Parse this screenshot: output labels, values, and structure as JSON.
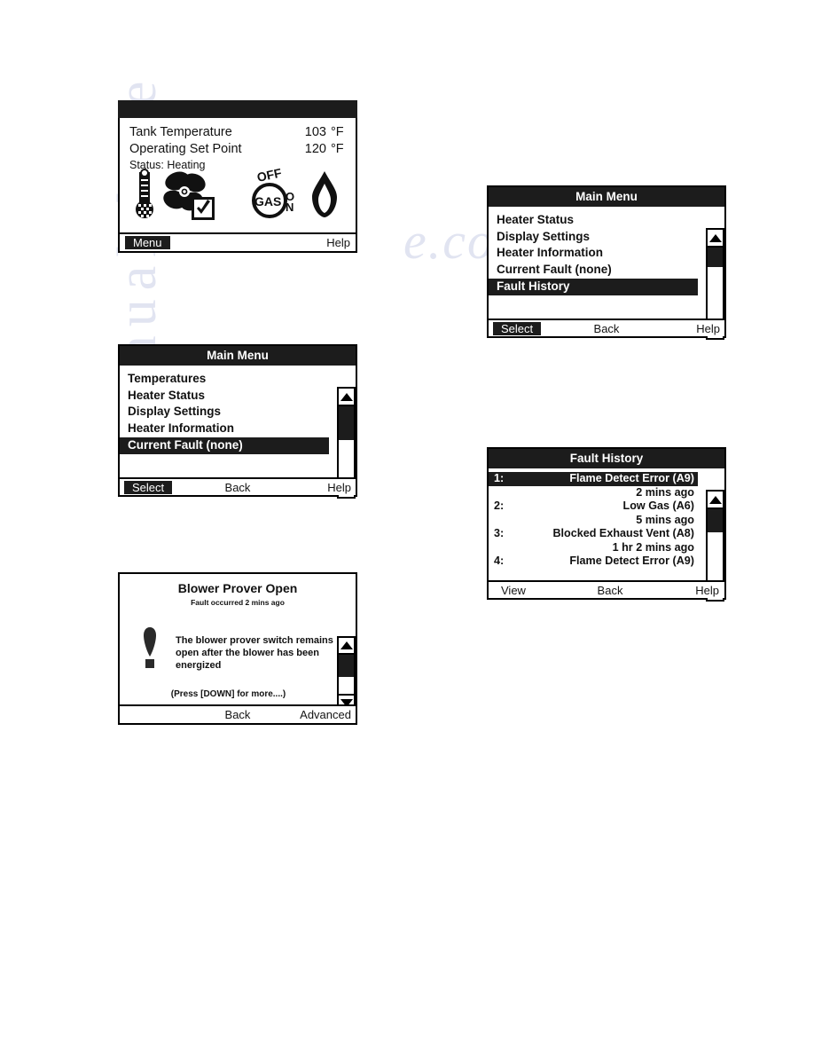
{
  "watermark": {
    "line1": "e.com",
    "line2": "manualshive"
  },
  "status_screen": {
    "rows": [
      {
        "label": "Tank Temperature",
        "value": "103",
        "unit": "°F"
      },
      {
        "label": "Operating Set Point",
        "value": "120",
        "unit": "°F"
      }
    ],
    "status_text": "Status: Heating",
    "icons": [
      {
        "name": "thermometer-icon",
        "label": "Thermometer"
      },
      {
        "name": "blower-fan-icon",
        "label": "Blower"
      },
      {
        "name": "gas-valve-icon",
        "label": "GAS",
        "off_label": "OFF",
        "on_label": "ON"
      },
      {
        "name": "flame-icon",
        "label": "Flame"
      }
    ],
    "footer": {
      "left": "Menu",
      "center": "",
      "right": "Help",
      "highlight": "left"
    }
  },
  "main_menu_1": {
    "title": "Main Menu",
    "items": [
      {
        "label": "Temperatures",
        "selected": false
      },
      {
        "label": "Heater Status",
        "selected": false
      },
      {
        "label": "Display Settings",
        "selected": false
      },
      {
        "label": "Heater Information",
        "selected": false
      },
      {
        "label": "Current Fault (none)",
        "selected": true
      }
    ],
    "footer": {
      "left": "Select",
      "center": "Back",
      "right": "Help",
      "highlight": "left"
    }
  },
  "main_menu_2": {
    "title": "Main Menu",
    "items": [
      {
        "label": "Heater Status",
        "selected": false
      },
      {
        "label": "Display Settings",
        "selected": false
      },
      {
        "label": "Heater Information",
        "selected": false
      },
      {
        "label": "Current Fault (none)",
        "selected": false
      },
      {
        "label": "Fault History",
        "selected": true
      }
    ],
    "footer": {
      "left": "Select",
      "center": "Back",
      "right": "Help",
      "highlight": "left"
    }
  },
  "fault_detail": {
    "title": "Blower Prover Open",
    "subtitle": "Fault  occurred 2 mins ago",
    "body": "The blower prover switch remains open after the blower has been energized",
    "more_hint": "(Press [DOWN] for more....)",
    "icon": "exclamation-icon",
    "footer": {
      "left": "",
      "center": "Back",
      "right": "Advanced",
      "highlight": "none"
    }
  },
  "fault_history": {
    "title": "Fault History",
    "entries": [
      {
        "num": "1:",
        "name": "Flame Detect Error (A9)",
        "time": "2 mins ago",
        "selected": true
      },
      {
        "num": "2:",
        "name": "Low Gas (A6)",
        "time": "5 mins ago",
        "selected": false
      },
      {
        "num": "3:",
        "name": "Blocked Exhaust Vent (A8)",
        "time": "1 hr 2 mins ago",
        "selected": false
      },
      {
        "num": "4:",
        "name": "Flame Detect Error (A9)",
        "time": "",
        "selected": false
      }
    ],
    "footer": {
      "left": "View",
      "center": "Back",
      "right": "Help",
      "highlight": "none"
    }
  }
}
